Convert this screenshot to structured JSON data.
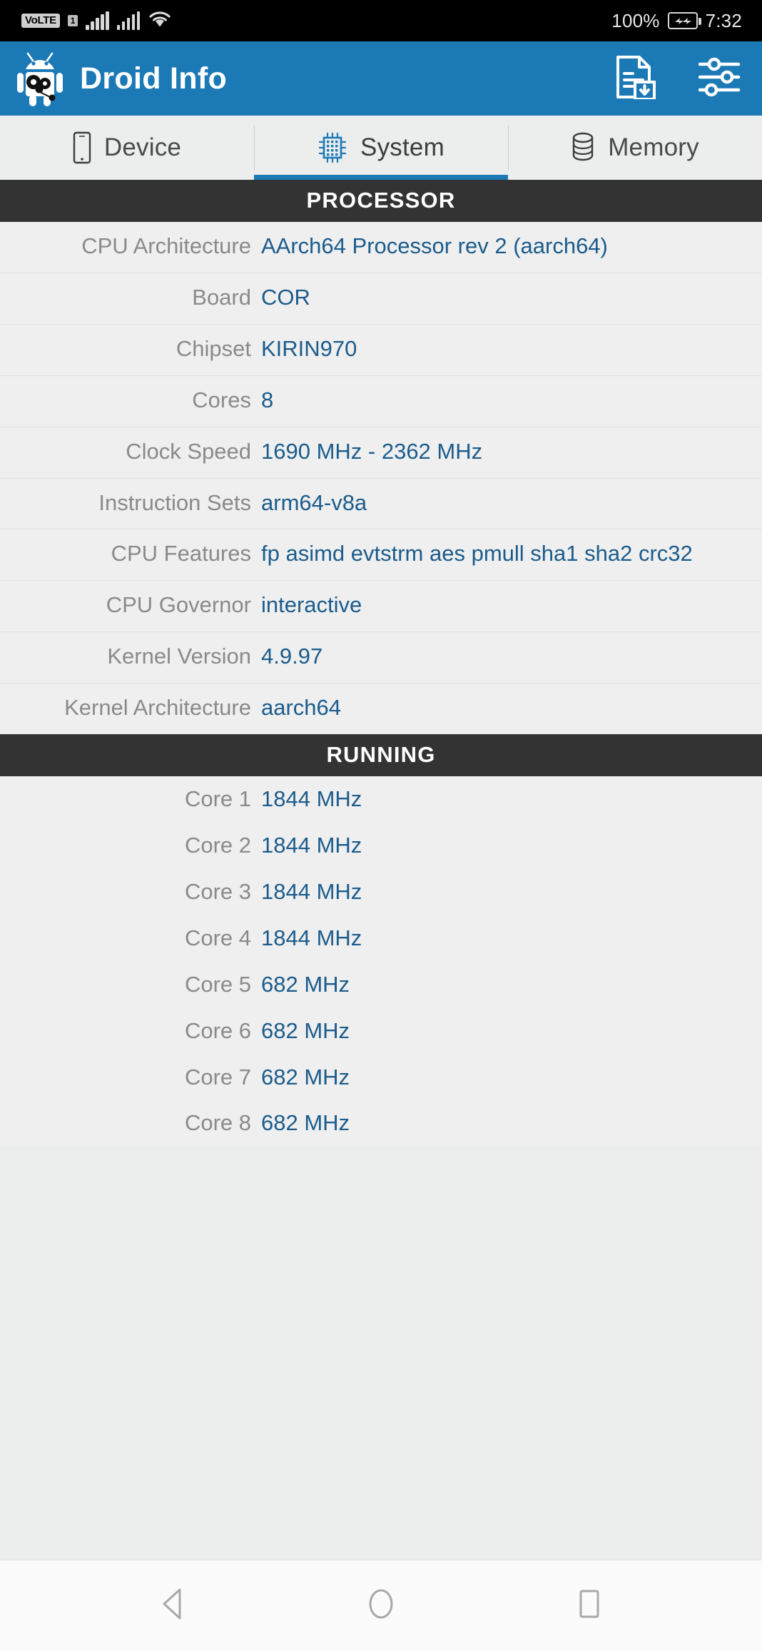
{
  "status_bar": {
    "volte_label": "VoLTE",
    "sim_label": "1",
    "battery_percent": "100%",
    "time": "7:32",
    "icons": [
      "volte-icon",
      "sim-indicator-icon",
      "signal-bars-icon",
      "signal-bars-icon",
      "wifi-icon",
      "battery-charging-icon"
    ]
  },
  "app_bar": {
    "title": "Droid Info",
    "logo_icon": "droid-info-logo",
    "actions": [
      {
        "name": "export-report-button",
        "icon": "document-download-icon"
      },
      {
        "name": "settings-button",
        "icon": "sliders-icon"
      }
    ]
  },
  "tabs": [
    {
      "label": "Device",
      "icon": "phone-icon",
      "active": false
    },
    {
      "label": "System",
      "icon": "cpu-chip-icon",
      "active": true
    },
    {
      "label": "Memory",
      "icon": "database-icon",
      "active": false
    }
  ],
  "sections": [
    {
      "header": "PROCESSOR",
      "divided": true,
      "rows": [
        {
          "label": "CPU Architecture",
          "value": "AArch64 Processor rev 2 (aarch64)"
        },
        {
          "label": "Board",
          "value": "COR"
        },
        {
          "label": "Chipset",
          "value": "KIRIN970"
        },
        {
          "label": "Cores",
          "value": "8"
        },
        {
          "label": "Clock Speed",
          "value": "1690 MHz - 2362 MHz"
        },
        {
          "label": "Instruction Sets",
          "value": "arm64-v8a"
        },
        {
          "label": "CPU Features",
          "value": "fp asimd evtstrm aes pmull sha1 sha2 crc32"
        },
        {
          "label": "CPU Governor",
          "value": "interactive"
        },
        {
          "label": "Kernel Version",
          "value": "4.9.97"
        },
        {
          "label": "Kernel Architecture",
          "value": "aarch64"
        }
      ]
    },
    {
      "header": "RUNNING",
      "divided": false,
      "rows": [
        {
          "label": "Core 1",
          "value": "1844 MHz"
        },
        {
          "label": "Core 2",
          "value": "1844 MHz"
        },
        {
          "label": "Core 3",
          "value": "1844 MHz"
        },
        {
          "label": "Core 4",
          "value": "1844 MHz"
        },
        {
          "label": "Core 5",
          "value": "682 MHz"
        },
        {
          "label": "Core 6",
          "value": "682 MHz"
        },
        {
          "label": "Core 7",
          "value": "682 MHz"
        },
        {
          "label": "Core 8",
          "value": "682 MHz"
        }
      ]
    }
  ],
  "nav_bar": [
    {
      "name": "back-button",
      "icon": "back-triangle-icon"
    },
    {
      "name": "home-button",
      "icon": "home-circle-icon"
    },
    {
      "name": "recents-button",
      "icon": "recents-square-icon"
    }
  ],
  "colors": {
    "accent": "#1b79b5",
    "value_text": "#1b5c8c",
    "label_text": "#8a8a8a",
    "section_header_bg": "#333333",
    "content_bg": "#efefef"
  }
}
